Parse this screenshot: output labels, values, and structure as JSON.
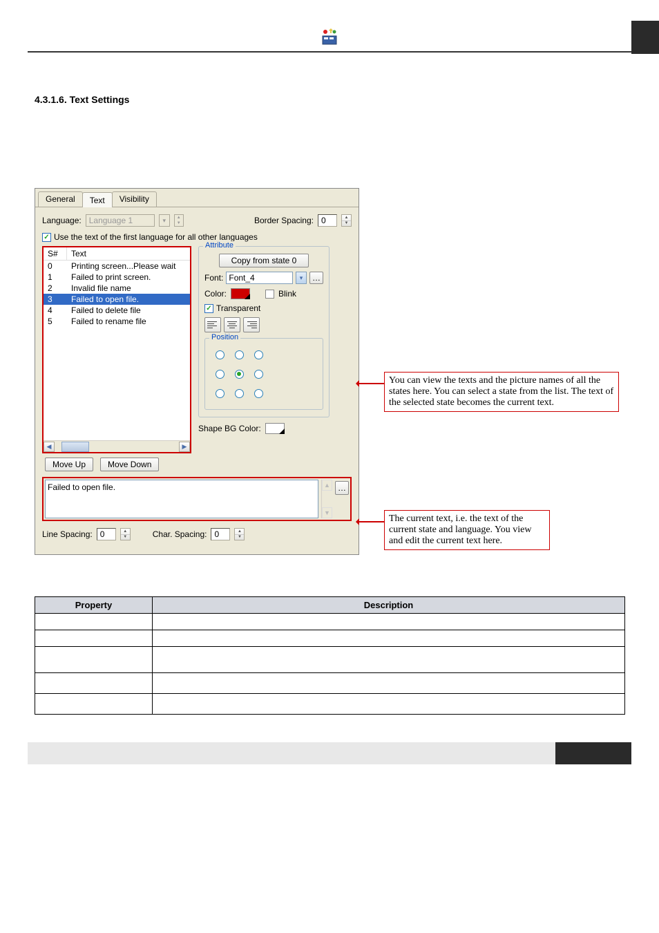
{
  "section_heading": "4.3.1.6.  Text Settings",
  "tabs": {
    "general": "General",
    "text": "Text",
    "visibility": "Visibility"
  },
  "labels": {
    "language": "Language:",
    "border_spacing": "Border Spacing:",
    "checkbox_first_lang": "Use the text of the first language for all other languages",
    "move_up": "Move Up",
    "move_down": "Move Down",
    "attribute": "Attribute",
    "copy_from": "Copy from state 0",
    "font": "Font:",
    "color": "Color:",
    "blink": "Blink",
    "transparent": "Transparent",
    "position": "Position",
    "shape_bg": "Shape BG Color:",
    "line_spacing": "Line Spacing:",
    "char_spacing": "Char. Spacing:"
  },
  "values": {
    "language_value": "Language 1",
    "border_spacing_value": "0",
    "font_value": "Font_4",
    "current_text": "Failed to open file.",
    "line_spacing_value": "0",
    "char_spacing_value": "0"
  },
  "list": {
    "col_s": "S#",
    "col_t": "Text",
    "rows": [
      {
        "s": "0",
        "t": "Printing screen...Please wait"
      },
      {
        "s": "1",
        "t": "Failed to print screen."
      },
      {
        "s": "2",
        "t": "Invalid file name"
      },
      {
        "s": "3",
        "t": "Failed to open file."
      },
      {
        "s": "4",
        "t": "Failed to delete file"
      },
      {
        "s": "5",
        "t": "Failed to rename file"
      }
    ],
    "selected_index": 3
  },
  "callouts": {
    "c1": "You can view the texts and the picture names of all the states here. You can select a state from the list. The text of the selected state becomes the current text.",
    "c2": "The current text, i.e. the text of the current state and language. You view and edit the current text here."
  },
  "table": {
    "head_property": "Property",
    "head_description": "Description"
  },
  "colors": {
    "text_color": "#c00000"
  }
}
